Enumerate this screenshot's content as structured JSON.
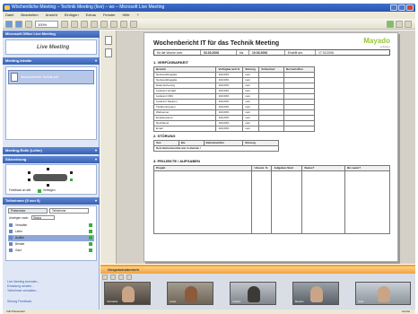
{
  "window": {
    "title": "Wöchentliche Meeting – Technik Meeting (live) – ws – Microsoft Live Meeting"
  },
  "menu": [
    "Datei",
    "Bearbeiten",
    "Ansicht",
    "Einfügen",
    "Extras",
    "Fenster",
    "Hilfe",
    "?"
  ],
  "toolbar": {
    "zoom": "100%"
  },
  "left": {
    "panel1_title": "Microsoft Office Live Meeting",
    "logo_text": "Live Meeting",
    "panel2_title": "Meeting-Inhalte",
    "content_item": "Wochenbericht Technik.pdf",
    "panel3_title": "Meeting-Rolle (Leiter)",
    "panel4_title": "Sitzordnung",
    "seating_label": "Feedback an alle",
    "seating_check": "Verfolgen",
    "panel5_title": "Teilnehmer (5 von 5)",
    "tabs": [
      "Präsentator",
      "Teilnehmer"
    ],
    "filter_label": "Anzeigen nach:",
    "filter_value": "Status",
    "attendees": [
      "Verwalter",
      "Leiter",
      "Auditor",
      "Berater",
      "Gast"
    ],
    "bottom_links": [
      "Live Meeting beenden...",
      "Einladung senden...",
      "Teilnehmer verwalten..."
    ],
    "status_link": "Sitzung Feedback"
  },
  "doc": {
    "title": "Wochenbericht IT für das Technik Meeting",
    "logo": "Mayado",
    "logo_sub": "software",
    "meta": [
      "für die Woche vom:",
      "03.03.2006",
      "bis",
      "10.03.2006",
      "Erstellt am:",
      "17.03.2006"
    ],
    "section1": "1. VERFÜGBARKEIT",
    "avail_headers": [
      "Bereich",
      "Verfügbar-keit %",
      "Störung",
      "Zeitverlust",
      "Bei betroffen"
    ],
    "avail_rows": [
      [
        "Netzwerkfreigabe",
        "100,00%",
        "nein"
      ],
      [
        "Netzwerkfreigabe",
        "100,00%",
        "nein"
      ],
      [
        "Datensicherung",
        "100,00%",
        "nein"
      ],
      [
        "Lieferant Verdatt",
        "100,00%",
        "nein"
      ],
      [
        "Lieferant ODC",
        "100,00%",
        "nein"
      ],
      [
        "Lieferant Telekom",
        "100,00%",
        "nein"
      ],
      [
        "Tiefdrucksystem",
        "100,00%",
        "nein"
      ],
      [
        "Webserver",
        "100,00%",
        "nein"
      ],
      [
        "Emailsysteme",
        "100,00%",
        "nein"
      ],
      [
        "Netzdienst",
        "100,00%",
        "nein"
      ],
      [
        "Email",
        "100,00%",
        "nein"
      ]
    ],
    "section2": "2. STÖRUNG",
    "störung_headers": [
      "Von",
      "Bis",
      "Betriebsmittel",
      "Störung"
    ],
    "störung_row": "Kein Betriebsmittel war in Betrieb !",
    "section3": "3. PROJEKTE / AUFGABEN",
    "proj_headers": [
      "Projekt",
      "Umsetz. %",
      "Aufgaben Start",
      "Status?",
      "Bis wann?"
    ]
  },
  "video": {
    "title": "Gesprächsbereich",
    "names": [
      "Verwalter",
      "Leiter",
      "Auditor",
      "Berater",
      "Gast"
    ]
  },
  "status": {
    "left": "Voll Präsentator",
    "right": "Extras"
  }
}
